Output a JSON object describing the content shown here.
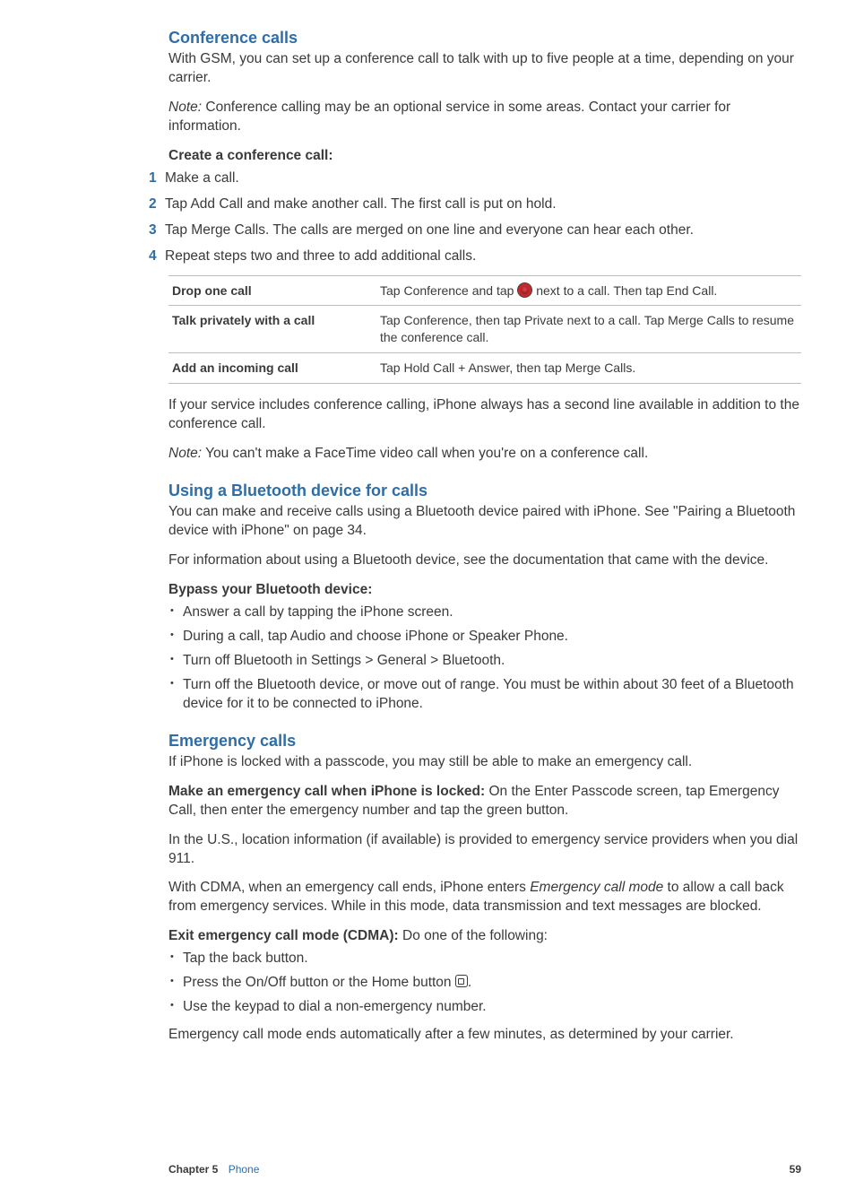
{
  "sections": {
    "conference": {
      "heading": "Conference calls",
      "intro": "With GSM, you can set up a conference call to talk with up to five people at a time, depending on your carrier.",
      "note_label": "Note:",
      "note_text": "Conference calling may be an optional service in some areas. Contact your carrier for information.",
      "create_label": "Create a conference call:",
      "steps": [
        "Make a call.",
        "Tap Add Call and make another call. The first call is put on hold.",
        "Tap Merge Calls. The calls are merged on one line and everyone can hear each other.",
        "Repeat steps two and three to add additional calls."
      ],
      "table": [
        {
          "left": "Drop one call",
          "right_pre": "Tap Conference and tap ",
          "right_post": " next to a call. Then tap End Call."
        },
        {
          "left": "Talk privately with a call",
          "right": "Tap Conference, then tap Private next to a call. Tap Merge Calls to resume the conference call."
        },
        {
          "left": "Add an incoming call",
          "right": "Tap Hold Call + Answer, then tap Merge Calls."
        }
      ],
      "after1": "If your service includes conference calling, iPhone always has a second line available in addition to the conference call.",
      "after_note_label": "Note:",
      "after_note_text": "You can't make a FaceTime video call when you're on a conference call."
    },
    "bluetooth": {
      "heading": "Using a Bluetooth device for calls",
      "p1": "You can make and receive calls using a Bluetooth device paired with iPhone. See \"Pairing a Bluetooth device with iPhone\" on page 34.",
      "p2": "For information about using a Bluetooth device, see the documentation that came with the device.",
      "bypass_label": "Bypass your Bluetooth device:",
      "bullets": [
        "Answer a call by tapping the iPhone screen.",
        "During a call, tap Audio and choose iPhone or Speaker Phone.",
        "Turn off Bluetooth in Settings > General > Bluetooth.",
        "Turn off the Bluetooth device, or move out of range. You must be within about 30 feet of a Bluetooth device for it to be connected to iPhone."
      ]
    },
    "emergency": {
      "heading": "Emergency calls",
      "p1": "If iPhone is locked with a passcode, you may still be able to make an emergency call.",
      "make_label": "Make an emergency call when iPhone is locked:",
      "make_text": "On the Enter Passcode screen, tap Emergency Call, then enter the emergency number and tap the green button.",
      "p2": "In the U.S., location information (if available) is provided to emergency service providers when you dial 911.",
      "p3_pre": "With CDMA, when an emergency call ends, iPhone enters ",
      "p3_em": "Emergency call mode",
      "p3_post": " to allow a call back from emergency services. While in this mode, data transmission and text messages are blocked.",
      "exit_label": "Exit emergency call mode (CDMA):",
      "exit_text": "Do one of the following:",
      "bullets": [
        "Tap the back button.",
        "Press the On/Off button or the Home button ",
        "Use the keypad to dial a non-emergency number."
      ],
      "tail": "Emergency call mode ends automatically after a few minutes, as determined by your carrier."
    }
  },
  "footer": {
    "chapter_label": "Chapter 5",
    "chapter_name": "Phone",
    "page_number": "59"
  }
}
